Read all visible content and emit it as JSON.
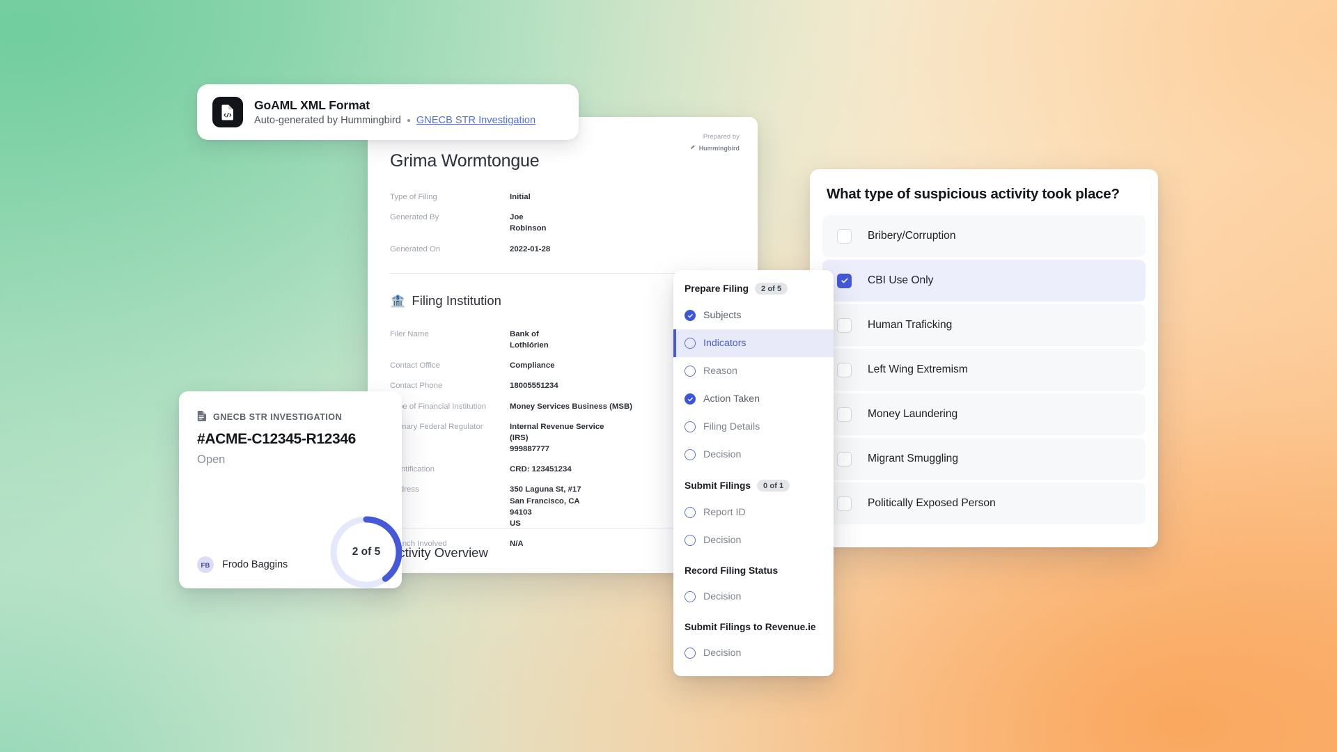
{
  "colors": {
    "accent_blue": "#4458d8",
    "link_blue": "#4f6ef2",
    "bg_green": "#8ed7ae",
    "bg_cream": "#f6f2e2",
    "bg_orange": "#f9a862",
    "checkbox_checked": "#4458d8",
    "badge_grey": "#e3e5e9"
  },
  "goaml_card": {
    "icon": "xml-file-icon",
    "title": "GoAML XML Format",
    "subtitle": "Auto-generated by Hummingbird",
    "separator": "•",
    "link": "GNECB STR Investigation"
  },
  "document": {
    "prepared_by_label": "Prepared by",
    "brand": "Hummingbird",
    "brand_icon": "hummingbird-logo-icon",
    "subject_name": "Grima Wormtongue",
    "summary_rows": [
      {
        "key": "Type of Filing",
        "value": [
          "Initial"
        ]
      },
      {
        "key": "Generated By",
        "value": [
          "Joe",
          "Robinson"
        ]
      },
      {
        "key": "Generated On",
        "value": [
          "2022-01-28"
        ]
      }
    ],
    "section": {
      "icon": "bank-icon",
      "title": "Filing Institution",
      "rows": [
        {
          "key": "Filer Name",
          "value": [
            "Bank of",
            "Lothlórien"
          ]
        },
        {
          "key": "Contact Office",
          "value": [
            "Compliance"
          ]
        },
        {
          "key": "Contact Phone",
          "value": [
            "18005551234"
          ]
        },
        {
          "key": "Type of Financial Institution",
          "value": [
            "Money Services Business (MSB)"
          ]
        },
        {
          "key": "Primary Federal Regulator",
          "value": [
            "Internal Revenue Service",
            "(IRS)",
            "999887777"
          ]
        },
        {
          "key": "Identification",
          "value": [
            "CRD: 123451234"
          ],
          "value_prefix_bold": "CRD"
        },
        {
          "key": "Address",
          "value": [
            "350 Laguna St, #17",
            "San Francisco, CA",
            "94103",
            "US"
          ]
        },
        {
          "key": "Branch Involved",
          "value": [
            "N/A"
          ]
        }
      ]
    },
    "activity_overview_title": "Activity Overview"
  },
  "case_card": {
    "type_icon": "document-icon",
    "type_label": "GNECB STR INVESTIGATION",
    "case_id": "#ACME-C12345-R12346",
    "status": "Open",
    "assignee": {
      "initials": "FB",
      "name": "Frodo Baggins"
    },
    "progress": {
      "label": "2 of 5",
      "completed": 2,
      "total": 5
    }
  },
  "checklist": {
    "groups": [
      {
        "title": "Prepare Filing",
        "badge": "2 of 5",
        "items": [
          {
            "label": "Subjects",
            "state": "done"
          },
          {
            "label": "Indicators",
            "state": "active"
          },
          {
            "label": "Reason",
            "state": "todo"
          },
          {
            "label": "Action Taken",
            "state": "done"
          },
          {
            "label": "Filing Details",
            "state": "todo"
          },
          {
            "label": "Decision",
            "state": "todo"
          }
        ]
      },
      {
        "title": "Submit Filings",
        "badge": "0 of 1",
        "items": [
          {
            "label": "Report ID",
            "state": "todo"
          },
          {
            "label": "Decision",
            "state": "todo"
          }
        ]
      },
      {
        "title": "Record Filing Status",
        "badge": "",
        "items": [
          {
            "label": "Decision",
            "state": "todo"
          }
        ]
      },
      {
        "title": "Submit Filings to Revenue.ie",
        "badge": "",
        "items": [
          {
            "label": "Decision",
            "state": "todo"
          }
        ]
      }
    ]
  },
  "activity_panel": {
    "question": "What type of suspicious activity took place?",
    "options": [
      {
        "label": "Bribery/Corruption",
        "checked": false
      },
      {
        "label": "CBI Use Only",
        "checked": true
      },
      {
        "label": "Human Traficking",
        "checked": false
      },
      {
        "label": "Left Wing Extremism",
        "checked": false
      },
      {
        "label": "Money Laundering",
        "checked": false
      },
      {
        "label": "Migrant Smuggling",
        "checked": false
      },
      {
        "label": "Politically Exposed Person",
        "checked": false
      }
    ]
  }
}
